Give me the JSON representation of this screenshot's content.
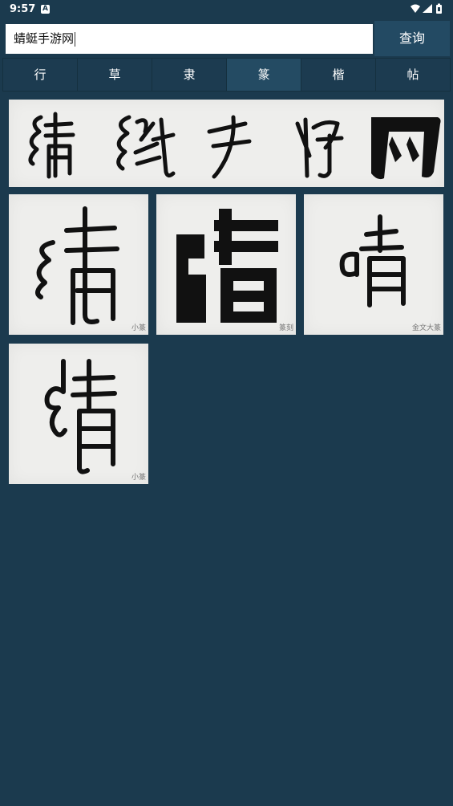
{
  "status": {
    "time": "9:57",
    "a_badge": "A"
  },
  "search": {
    "value": "蜻蜓手游网",
    "query_label": "查询"
  },
  "tabs": [
    {
      "label": "行",
      "active": false
    },
    {
      "label": "草",
      "active": false
    },
    {
      "label": "隶",
      "active": false
    },
    {
      "label": "篆",
      "active": true
    },
    {
      "label": "楷",
      "active": false
    },
    {
      "label": "帖",
      "active": false
    }
  ],
  "results": [
    {
      "style": "小篆"
    },
    {
      "style": "篆刻"
    },
    {
      "style": "金文大篆"
    },
    {
      "style": "小篆"
    }
  ]
}
